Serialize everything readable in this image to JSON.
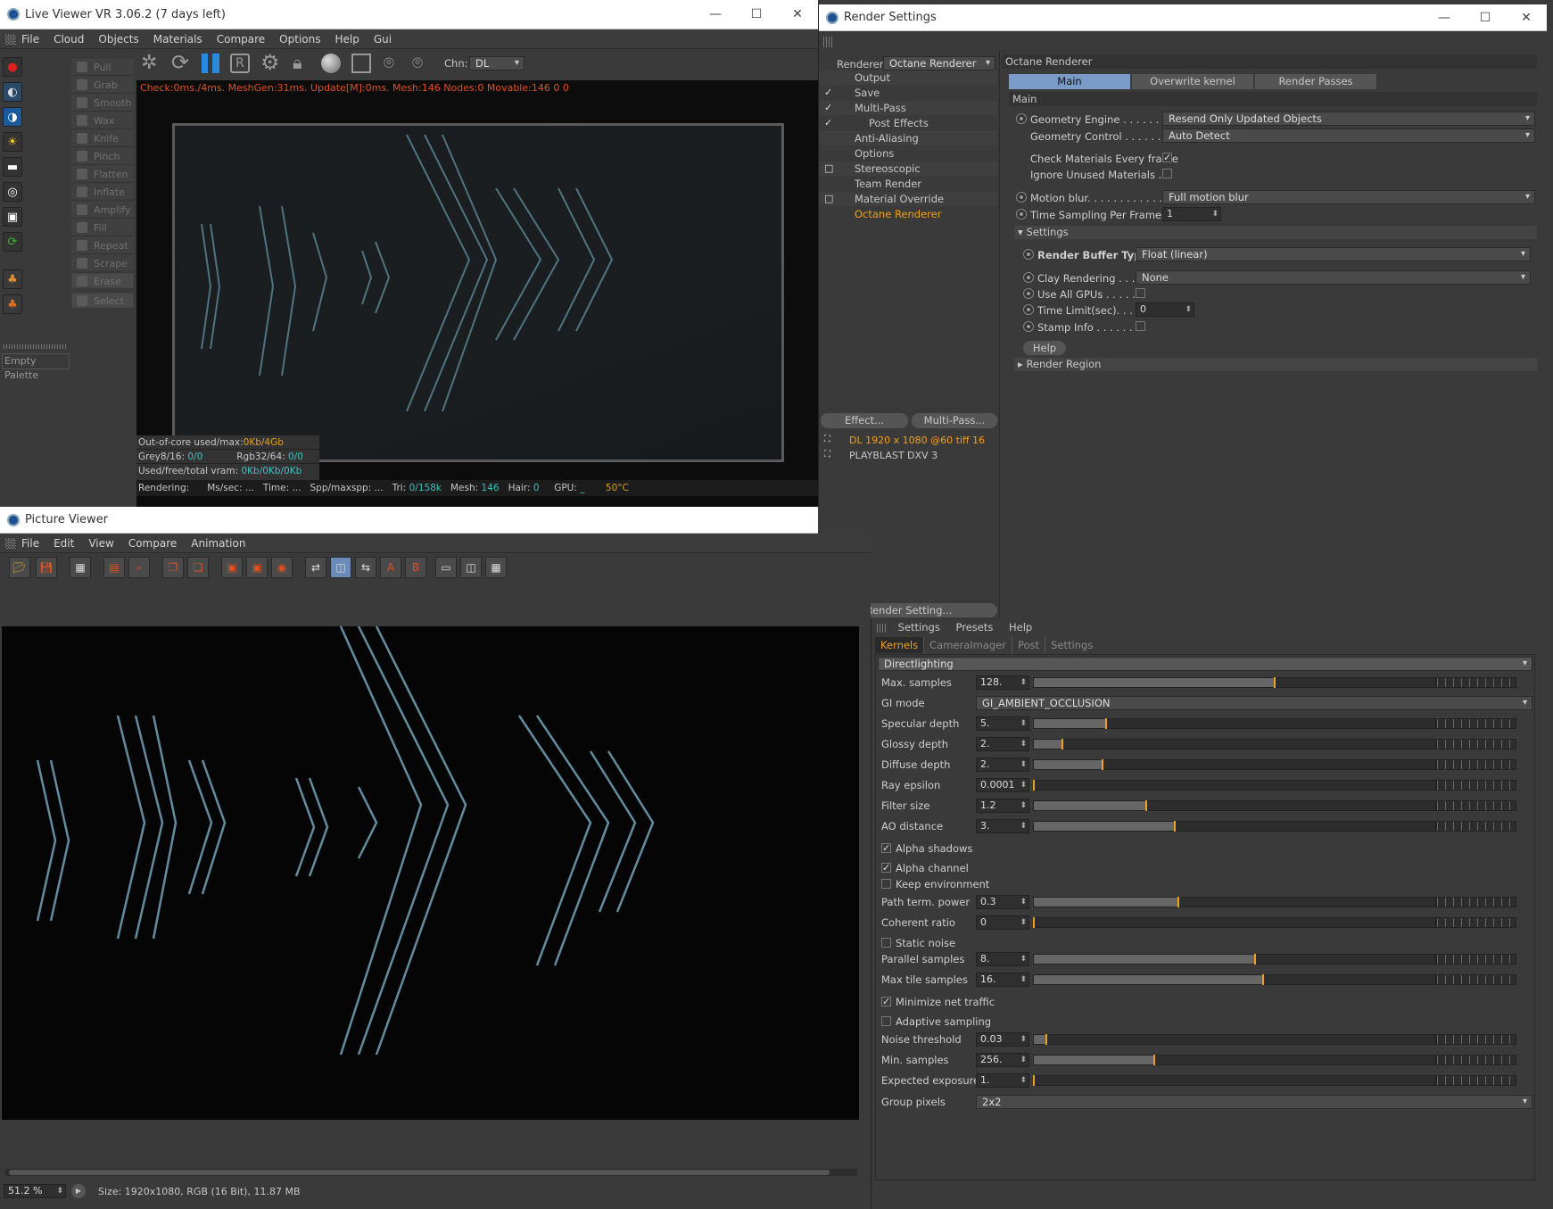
{
  "live_viewer": {
    "title": "Live Viewer VR 3.06.2 (7 days left)",
    "menu": [
      "File",
      "Cloud",
      "Objects",
      "Materials",
      "Compare",
      "Options",
      "Help",
      "Gui"
    ],
    "channel_label": "Chn:",
    "channel_value": "DL",
    "status_line": "Check:0ms./4ms. MeshGen:31ms. Update[M]:0ms. Mesh:146 Nodes:0 Movable:146  0 0",
    "palette_buttons": [
      "Pull",
      "Grab",
      "Smooth",
      "Wax",
      "Knife",
      "Pinch",
      "Flatten",
      "Inflate",
      "Amplify",
      "Fill",
      "Repeat",
      "Scrape",
      "Erase",
      "Select"
    ],
    "empty_palette": "Empty Palette",
    "info": {
      "out_of_core_label": "Out-of-core used/max:",
      "out_of_core_value": "0Kb/4Gb",
      "grey_label": "Grey8/16:",
      "grey_value": "0/0",
      "rgb_label": "Rgb32/64:",
      "rgb_value": "0/0",
      "vram_label": "Used/free/total vram:",
      "vram_value": "0Kb/0Kb/0Kb"
    },
    "bottom_status": {
      "rendering": "Rendering:",
      "ms_sec": "Ms/sec: ...",
      "time": "Time: ...",
      "spp": "Spp/maxspp: ...",
      "tri_label": "Tri:",
      "tri_value": "0/158k",
      "mesh_label": "Mesh:",
      "mesh_value": "146",
      "hair_label": "Hair:",
      "hair_value": "0",
      "gpu_label": "GPU:",
      "gpu_value": "_",
      "temp": "50°C"
    }
  },
  "render_settings": {
    "title": "Render Settings",
    "renderer_label": "Renderer",
    "renderer_value": "Octane Renderer",
    "tree": [
      {
        "label": "Output",
        "check": ""
      },
      {
        "label": "Save",
        "check": "✓"
      },
      {
        "label": "Multi-Pass",
        "check": "✓"
      },
      {
        "label": "Post Effects",
        "check": "✓"
      },
      {
        "label": "Anti-Aliasing",
        "check": ""
      },
      {
        "label": "Options",
        "check": ""
      },
      {
        "label": "Stereoscopic",
        "check": "□"
      },
      {
        "label": "Team Render",
        "check": ""
      },
      {
        "label": "Material Override",
        "check": "□"
      },
      {
        "label": "Octane Renderer",
        "check": ""
      }
    ],
    "effect_button": "Effect...",
    "multipass_button": "Multi-Pass...",
    "presets": [
      "DL 1920 x 1080 @60 tiff 16",
      "PLAYBLAST  DXV 3"
    ],
    "render_setting_button": "Render Setting...",
    "panel_title": "Octane Renderer",
    "tabs": [
      "Main",
      "Overwrite kernel Settings",
      "Render Passes"
    ],
    "section_main": "Main",
    "geometry_engine_label": "Geometry Engine . . . . . . . .",
    "geometry_engine_value": "Resend Only Updated Objects",
    "geometry_control_label": "Geometry Control . . . . . . . .",
    "geometry_control_value": "Auto Detect",
    "check_materials_label": "Check Materials Every frame",
    "ignore_unused_label": "Ignore Unused Materials . .",
    "motion_blur_label": "Motion blur. . . . . . . . . . . . .",
    "motion_blur_value": "Full motion blur",
    "time_sampling_label": "Time Sampling Per Frames",
    "time_sampling_value": "1",
    "settings_section": "Settings",
    "render_buffer_label": "Render Buffer Type",
    "render_buffer_value": "Float (linear)",
    "clay_label": "Clay Rendering . . .",
    "clay_value": "None",
    "use_all_gpus_label": "Use All GPUs . . . . .",
    "time_limit_label": "Time Limit(sec). . . .",
    "time_limit_value": "0",
    "stamp_info_label": "Stamp Info . . . . . . .",
    "help_button": "Help",
    "render_region": "Render Region"
  },
  "picture_viewer": {
    "title": "Picture Viewer",
    "menu": [
      "File",
      "Edit",
      "View",
      "Compare",
      "Animation"
    ],
    "zoom": "51.2 %",
    "size_info": "Size: 1920x1080, RGB (16 Bit), 11.87 MB"
  },
  "kernel_panel": {
    "menu": [
      "Settings",
      "Presets",
      "Help"
    ],
    "tabs": [
      "Kernels",
      "CameraImager",
      "Post",
      "Settings"
    ],
    "kernel_type": "Directlighting",
    "rows": [
      {
        "label": "Max. samples",
        "value": "128.",
        "fill": 0.6
      },
      {
        "label": "GI mode",
        "value": "GI_AMBIENT_OCCLUSION",
        "dropdown": true
      },
      {
        "label": "Specular depth",
        "value": "5.",
        "fill": 0.18
      },
      {
        "label": "Glossy depth",
        "value": "2.",
        "fill": 0.07
      },
      {
        "label": "Diffuse depth",
        "value": "2.",
        "fill": 0.17
      },
      {
        "label": "Ray epsilon",
        "value": "0.0001",
        "fill": 0.0
      },
      {
        "label": "Filter size",
        "value": "1.2",
        "fill": 0.28
      },
      {
        "label": "AO distance",
        "value": "3.",
        "fill": 0.35
      },
      {
        "check": "Alpha shadows",
        "on": true
      },
      {
        "check": "Alpha channel",
        "on": true
      },
      {
        "check": "Keep environment",
        "on": false
      },
      {
        "label": "Path term. power",
        "value": "0.3",
        "fill": 0.36
      },
      {
        "label": "Coherent ratio",
        "value": "0",
        "fill": 0.0
      },
      {
        "check": "Static noise",
        "on": false
      },
      {
        "label": "Parallel samples",
        "value": "8.",
        "fill": 0.55
      },
      {
        "label": "Max tile samples",
        "value": "16.",
        "fill": 0.57
      },
      {
        "check": "Minimize net traffic",
        "on": true
      },
      {
        "check": "Adaptive sampling",
        "on": false
      },
      {
        "label": "Noise threshold",
        "value": "0.03",
        "fill": 0.03
      },
      {
        "label": "Min. samples",
        "value": "256.",
        "fill": 0.3
      },
      {
        "label": "Expected exposure",
        "value": "1.",
        "fill": 0.0
      },
      {
        "label": "Group pixels",
        "value": "2x2",
        "dropdown": true
      }
    ]
  },
  "colors": {
    "accent": "#f0a020",
    "tab_active": "#7a9ac8",
    "title_bg": "#ffffff",
    "panel_bg": "#3a3a3a"
  }
}
